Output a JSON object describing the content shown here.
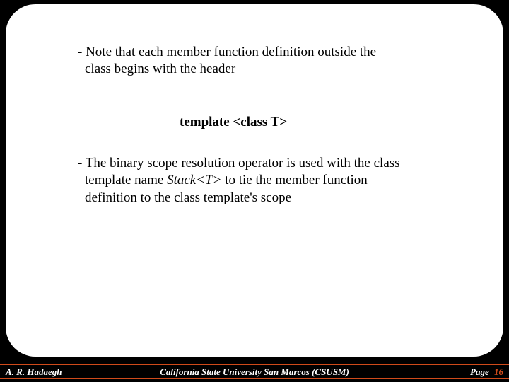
{
  "body": {
    "bullet1_line1": "- Note that each member function definition outside the",
    "bullet1_line2": "class begins with the header",
    "template_header": "template <class T>",
    "bullet2_line1": "- The binary scope resolution operator is used with the class",
    "bullet2_line2_pre": "template name ",
    "bullet2_line2_ital": "Stack<T>",
    "bullet2_line2_post": " to tie the member function",
    "bullet2_line3": "definition to the class template's scope"
  },
  "footer": {
    "author": "A. R. Hadaegh",
    "affiliation": "California State University San Marcos (CSUSM)",
    "page_label": "Page",
    "page_number": "16"
  }
}
